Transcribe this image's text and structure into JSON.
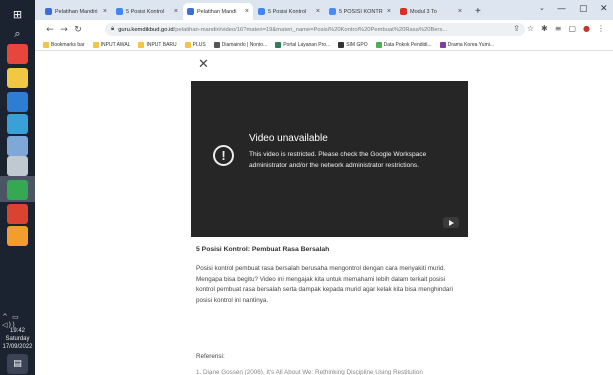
{
  "taskbar": {
    "icons": [
      {
        "name": "windows-start-icon",
        "color": "#ffffff"
      },
      {
        "name": "search-icon",
        "color": "#dddddd"
      },
      {
        "name": "chrome-icon",
        "color": "#e8453c"
      },
      {
        "name": "file-explorer-icon",
        "color": "#f2c744"
      },
      {
        "name": "app-icon-blue",
        "color": "#2d7dd2"
      },
      {
        "name": "app-icon-teal",
        "color": "#3aa0d8"
      },
      {
        "name": "app-icon-cloud",
        "color": "#7fa8d8"
      },
      {
        "name": "app-icon-paint",
        "color": "#c0c8d0"
      },
      {
        "name": "chrome-active-icon",
        "color": "#34a853"
      },
      {
        "name": "app-icon-red",
        "color": "#d9432f"
      },
      {
        "name": "app-icon-orange",
        "color": "#f29d2e"
      }
    ],
    "tray": "^ ▭ ◁))",
    "time": "19:42",
    "day": "Saturday",
    "date": "17/09/2022",
    "notification_icon": "notification-icon"
  },
  "browser": {
    "tabs": [
      {
        "label": "Pelatihan Mandiri",
        "favicon_color": "#3b6fd6",
        "active": false
      },
      {
        "label": "5 Posisi Kontrol",
        "favicon_color": "#4285f4",
        "active": false
      },
      {
        "label": "Pelatihan Mandi",
        "favicon_color": "#3b6fd6",
        "active": true
      },
      {
        "label": "5 Posisi Kontrol",
        "favicon_color": "#4285f4",
        "active": false
      },
      {
        "label": "5 POSISI KONTR",
        "favicon_color": "#4b8bf5",
        "active": false
      },
      {
        "label": "Modul 3 To",
        "favicon_color": "#d93025",
        "active": false
      }
    ],
    "new_tab": "+",
    "window_controls": [
      "⌄",
      "—",
      "▢",
      "✕"
    ],
    "url_host": "guru.kemdikbud.go.id",
    "url_path": "/pelatihan-mandiri/video/16?materi=19&materi_name=Posisi%20Kontrol%20Pembuat%20Rasa%20Bers...",
    "bookmarks": [
      {
        "label": "Bookmarks bar",
        "color": "#f4c542"
      },
      {
        "label": "INPUT AWAL",
        "color": "#f4c542"
      },
      {
        "label": "INPUT BARU",
        "color": "#f4c542"
      },
      {
        "label": "PLUS",
        "color": "#f4c542"
      },
      {
        "label": "Diamaindo | Nonto...",
        "color": "#555555"
      },
      {
        "label": "Portal Layanan Pro...",
        "color": "#2e7d5b"
      },
      {
        "label": "SIM GPO",
        "color": "#333333"
      },
      {
        "label": "Data Pokok Pendidi...",
        "color": "#4caf50"
      },
      {
        "label": "Drama Korea Yumi...",
        "color": "#7b3fa0"
      }
    ]
  },
  "video": {
    "title": "Video unavailable",
    "message": "This video is restricted. Please check the Google Workspace administrator and/or the network administrator restrictions."
  },
  "content": {
    "title": "5 Posisi Kontrol: Pembuat Rasa Bersalah",
    "body": "Posisi kontrol pembuat rasa bersalah berusaha mengontrol dengan cara menyakiti murid. Mengapa bisa begitu? Video ini mengajak kita untuk memahami lebih dalam terkait posisi kontrol pembuat rasa bersalah serta dampak kepada murid agar kelak kita bisa menghindari posisi kontrol ini nantinya.",
    "references_heading": "Referensi:",
    "references_cut": "1. Diane Gossen (2006). It's All About We: Rethinking Discipline Using Restitution"
  }
}
